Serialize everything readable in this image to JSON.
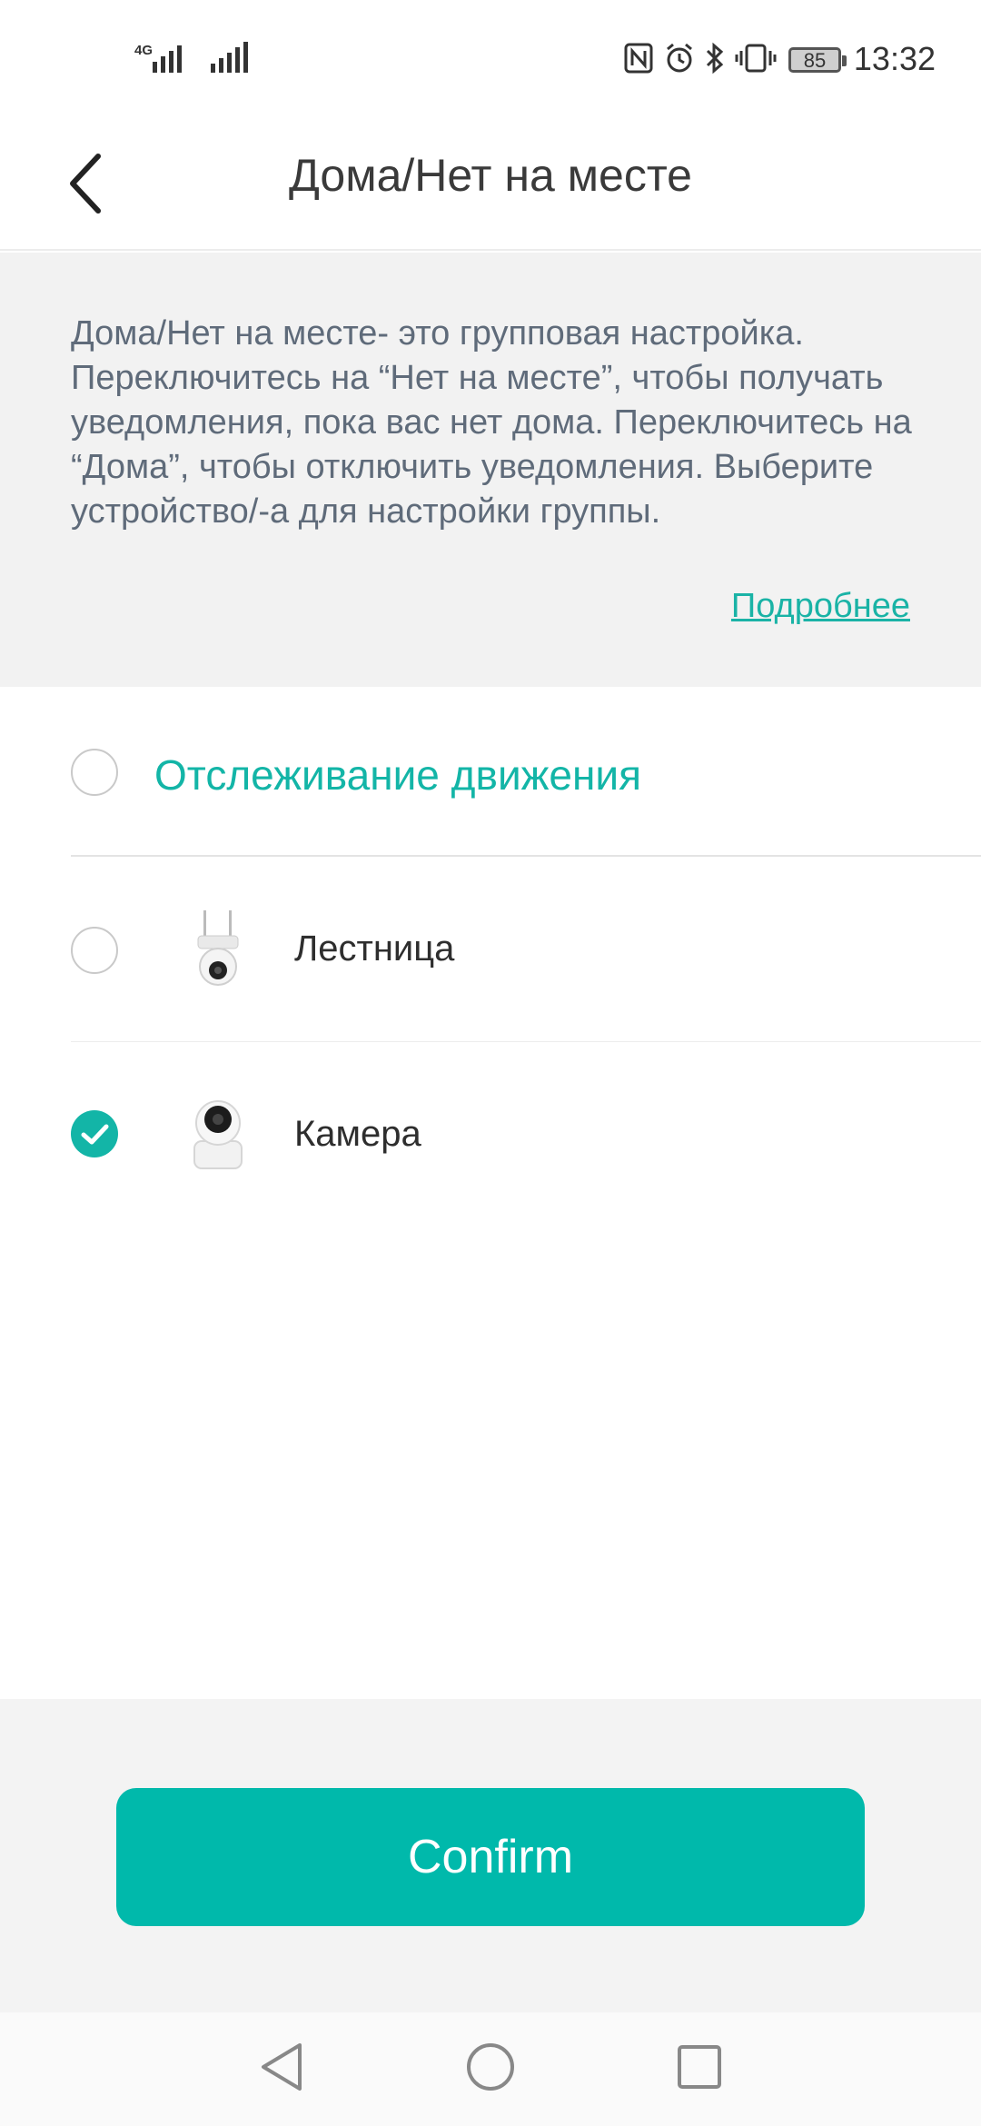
{
  "status_bar": {
    "network_label": "4G",
    "battery": "85",
    "time": "13:32"
  },
  "header": {
    "title": "Дома/Нет на месте"
  },
  "info": {
    "description": "Дома/Нет на месте- это групповая настройка. Переключитесь на “Нет на месте”, чтобы получать уведомления, пока вас нет дома. Переключитесь на “Дома”, чтобы отключить уведомления. Выберите устройство/-а для настройки группы.",
    "more_link": "Подробнее"
  },
  "group": {
    "label": "Отслеживание движения",
    "checked": false
  },
  "devices": [
    {
      "name": "Лестница",
      "checked": false,
      "icon": "outdoor-camera-icon"
    },
    {
      "name": "Камера",
      "checked": true,
      "icon": "indoor-camera-icon"
    }
  ],
  "confirm_label": "Confirm",
  "colors": {
    "accent": "#13b5a7",
    "button": "#00b9ab"
  }
}
